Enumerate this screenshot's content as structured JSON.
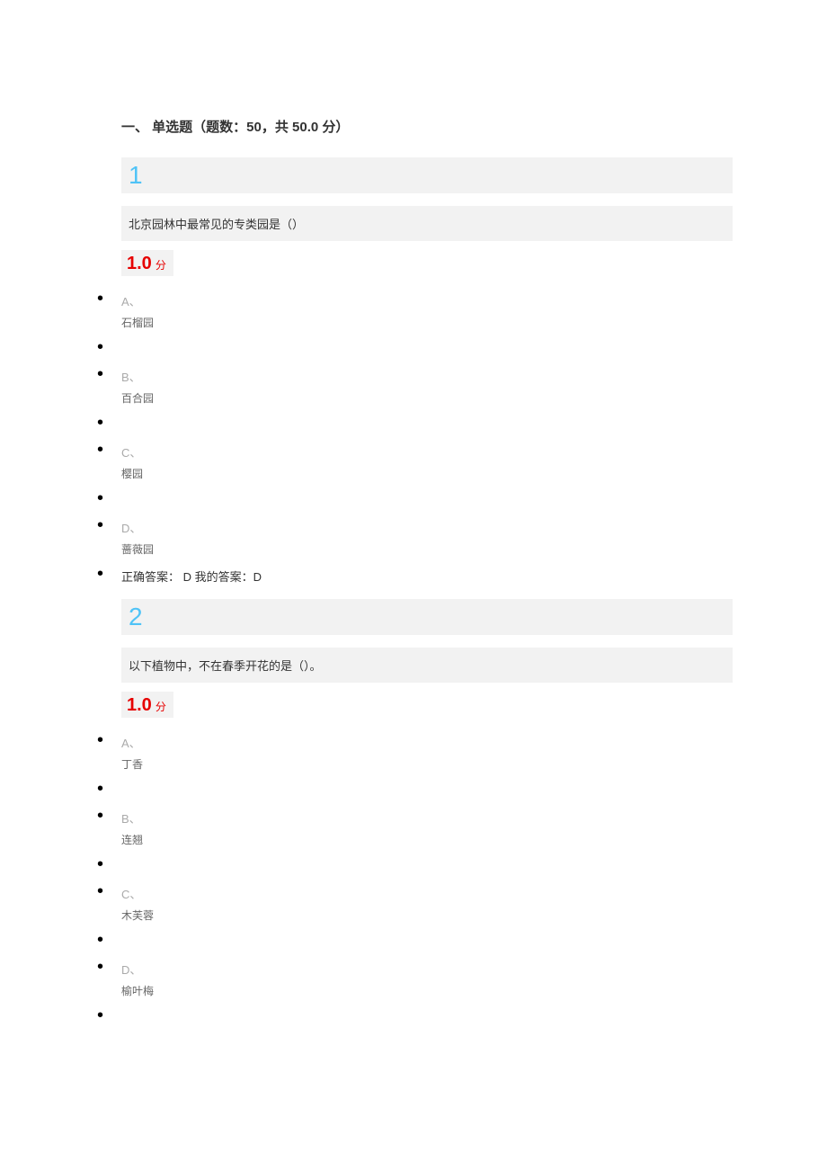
{
  "section_title": "一、 单选题（题数：50，共 50.0 分）",
  "questions": [
    {
      "number": "1",
      "text": "北京园林中最常见的专类园是（）",
      "score_value": "1.0",
      "score_unit": "分",
      "options": [
        {
          "label": "A、",
          "text": "石榴园"
        },
        {
          "label": "B、",
          "text": "百合园"
        },
        {
          "label": "C、",
          "text": "樱园"
        },
        {
          "label": "D、",
          "text": "蔷薇园"
        }
      ],
      "answer": "正确答案： D 我的答案：D"
    },
    {
      "number": "2",
      "text": "以下植物中，不在春季开花的是（）。",
      "score_value": "1.0",
      "score_unit": "分",
      "options": [
        {
          "label": "A、",
          "text": "丁香"
        },
        {
          "label": "B、",
          "text": "连翘"
        },
        {
          "label": "C、",
          "text": "木芙蓉"
        },
        {
          "label": "D、",
          "text": "榆叶梅"
        }
      ],
      "answer": ""
    }
  ]
}
